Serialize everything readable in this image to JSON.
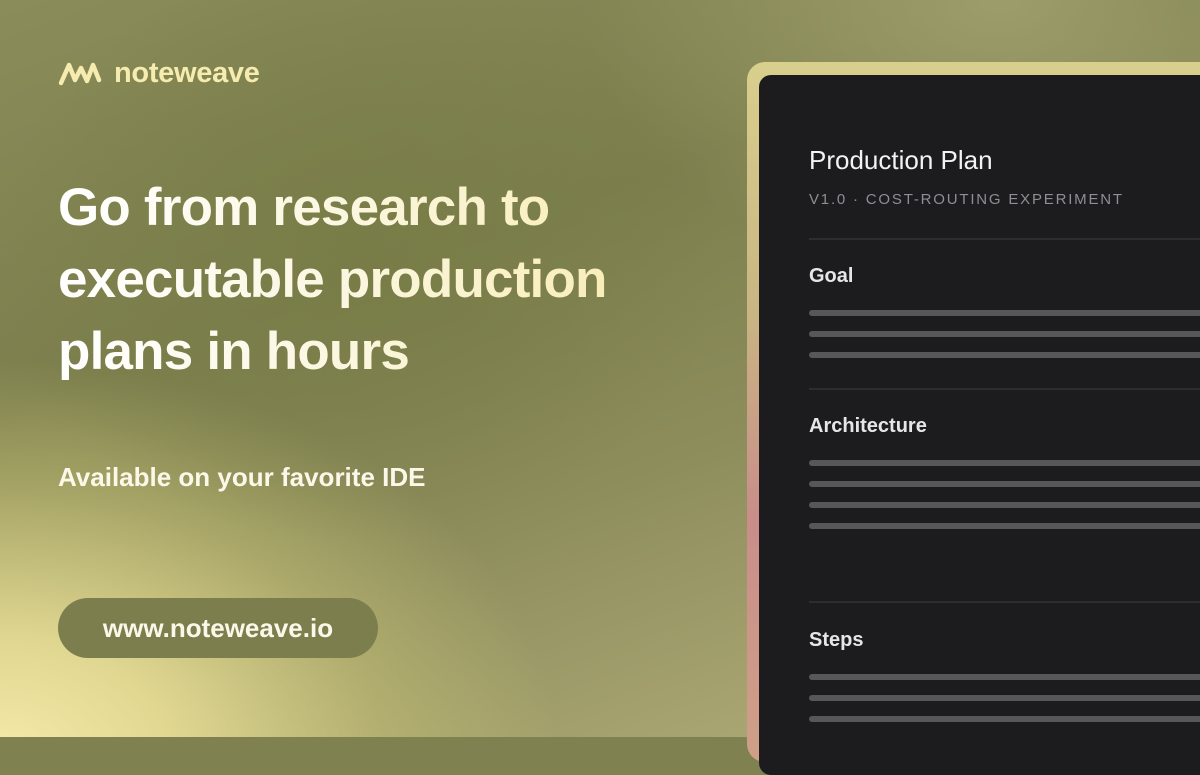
{
  "brand": {
    "name": "noteweave",
    "logo_icon": "wave-icon",
    "accent_color": "#f6ecb0"
  },
  "hero": {
    "headline": "Go from research to executable production plans in hours",
    "subtitle": "Available on your favorite IDE",
    "url": "www.noteweave.io"
  },
  "document": {
    "title": "Production Plan",
    "meta": "V1.0 · COST-ROUTING EXPERIMENT",
    "sections": [
      {
        "title": "Goal"
      },
      {
        "title": "Architecture"
      },
      {
        "title": "Steps"
      }
    ]
  }
}
